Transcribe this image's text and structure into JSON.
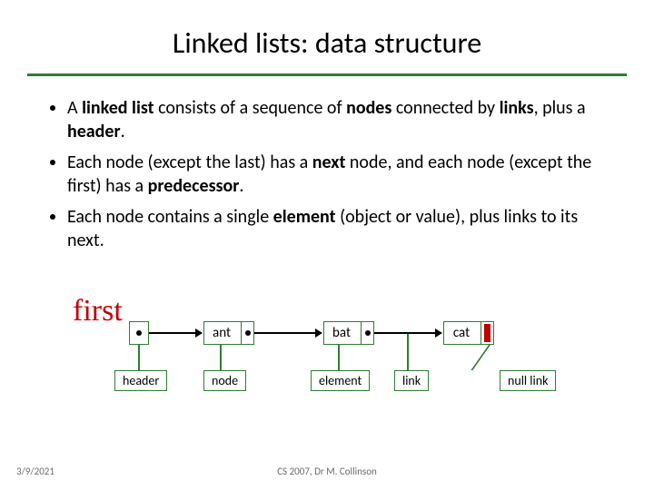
{
  "title": "Linked lists: data structure",
  "bullets": [
    {
      "pre": "A ",
      "b1": "linked list",
      "mid1": " consists of a sequence of ",
      "b2": "nodes",
      "mid2": " connected by ",
      "b3": "links",
      "mid3": ", plus a ",
      "b4": "header",
      "post": "."
    },
    {
      "pre": "Each node (except the last) has a ",
      "b1": "next",
      "mid1": " node, and each node (except the first) has a ",
      "b2": "predecessor",
      "post": "."
    },
    {
      "pre": "Each node contains a single ",
      "b1": "element",
      "mid1": " (object or value), plus links to its next.",
      "post": ""
    }
  ],
  "diagram": {
    "first_label": "first",
    "nodes": [
      "ant",
      "bat",
      "cat"
    ]
  },
  "labels": {
    "header": "header",
    "node": "node",
    "element": "element",
    "link": "link",
    "nulllink": "null link"
  },
  "footer": {
    "date": "3/9/2021",
    "course": "CS 2007,  Dr M. Collinson"
  },
  "colors": {
    "accent": "#2e7d32",
    "red": "#c00000"
  }
}
